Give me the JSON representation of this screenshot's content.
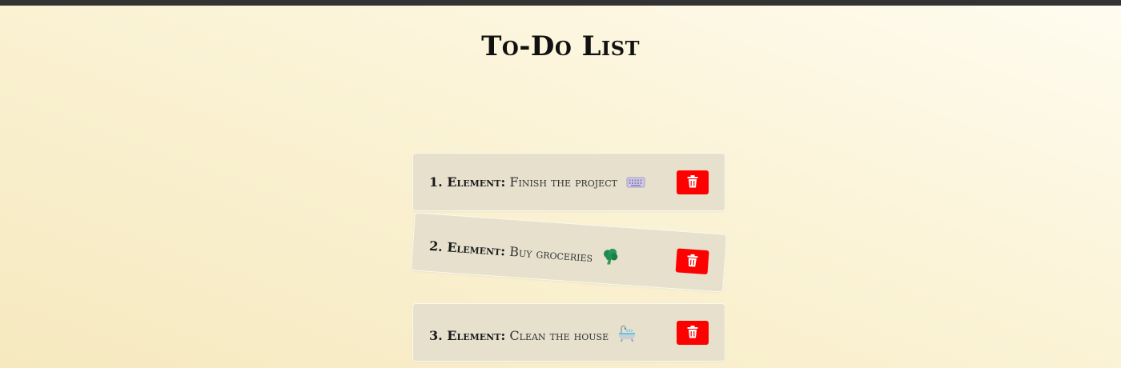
{
  "app": {
    "title": "To-Do List"
  },
  "todos": [
    {
      "number_label": "1. Element:",
      "text": "Finish the project",
      "icon": "keyboard-icon",
      "delete_icon": "trash-icon"
    },
    {
      "number_label": "2. Element:",
      "text": "Buy groceries",
      "icon": "broccoli-icon",
      "delete_icon": "trash-icon"
    },
    {
      "number_label": "3. Element:",
      "text": "Clean the house",
      "icon": "bathtub-icon",
      "delete_icon": "trash-icon"
    }
  ],
  "colors": {
    "delete_button": "#ff0000",
    "card_background": "#e6e0cd",
    "top_bar": "#333333"
  }
}
